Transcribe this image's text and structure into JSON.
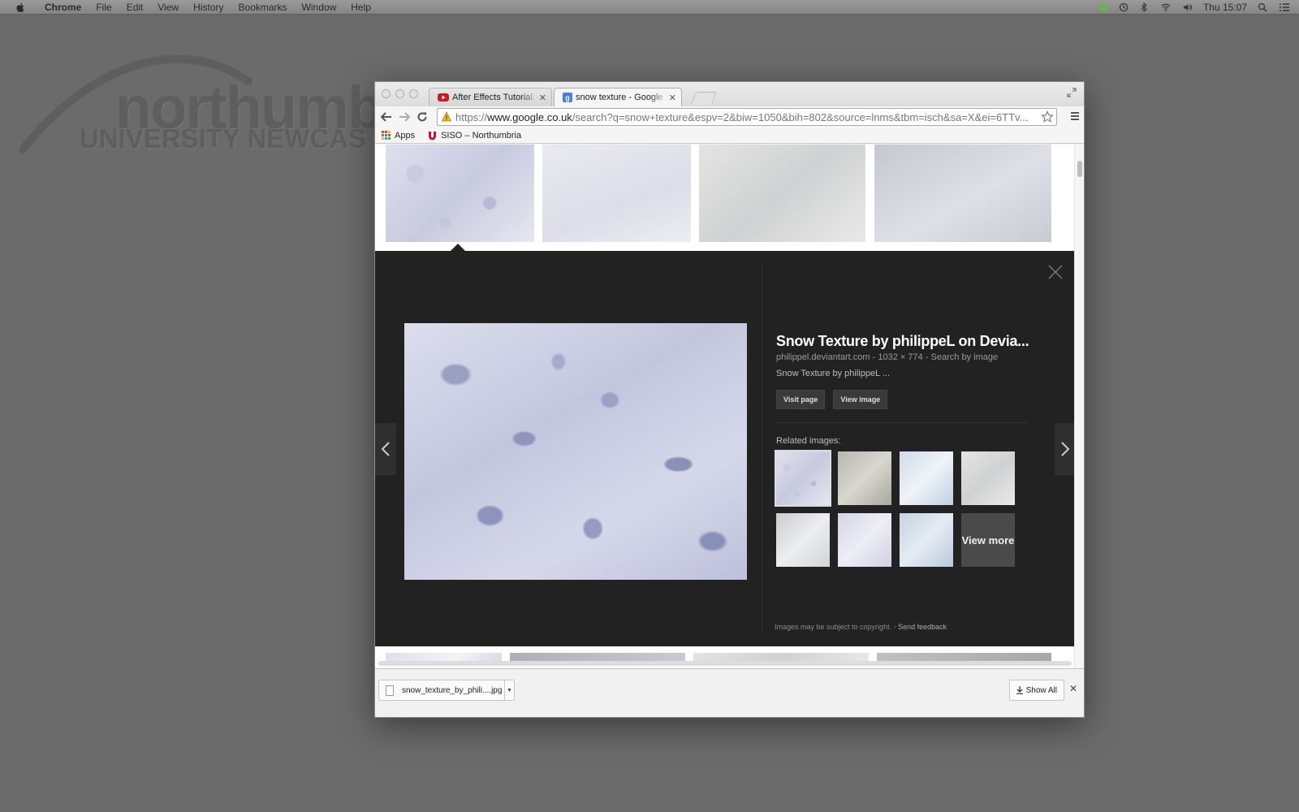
{
  "menubar": {
    "app_name": "Chrome",
    "items": [
      "File",
      "Edit",
      "View",
      "History",
      "Bookmarks",
      "Window",
      "Help"
    ],
    "clock": "Thu 15:07"
  },
  "desktop": {
    "logo_word": "northumbr",
    "logo_sub": "UNIVERSITY NEWCAS"
  },
  "browser": {
    "tabs": [
      {
        "title": "After Effects Tutorial: Anim",
        "icon": "youtube-icon",
        "active": false
      },
      {
        "title": "snow texture - Google Sea",
        "icon": "google-icon",
        "active": true
      }
    ],
    "url_scheme": "https://",
    "url_host": "www.google.co.uk",
    "url_rest": "/search?q=snow+texture&espv=2&biw=1050&bih=802&source=lnms&tbm=isch&sa=X&ei=6TTv...",
    "bookmarks": [
      {
        "label": "Apps",
        "icon": "apps-grid-icon"
      },
      {
        "label": "SISO – Northumbria",
        "icon": "northumbria-icon"
      }
    ]
  },
  "image_panel": {
    "title": "Snow Texture by philippeL on Devia...",
    "source": "philippel.deviantart.com",
    "dimensions": "1032 × 774",
    "search_by_image": "Search by image",
    "description": "Snow Texture by philippeL ...",
    "visit_page": "Visit page",
    "view_image": "View image",
    "related_label": "Related images:",
    "view_more": "View more",
    "copyright": "Images may be subject to copyright.",
    "send_feedback": "Send feedback"
  },
  "downloads": {
    "filename": "snow_texture_by_phili....jpg",
    "show_all": "Show All"
  },
  "colors": {
    "panel_bg": "#222222",
    "desktop_bg": "#6b6b6b"
  }
}
